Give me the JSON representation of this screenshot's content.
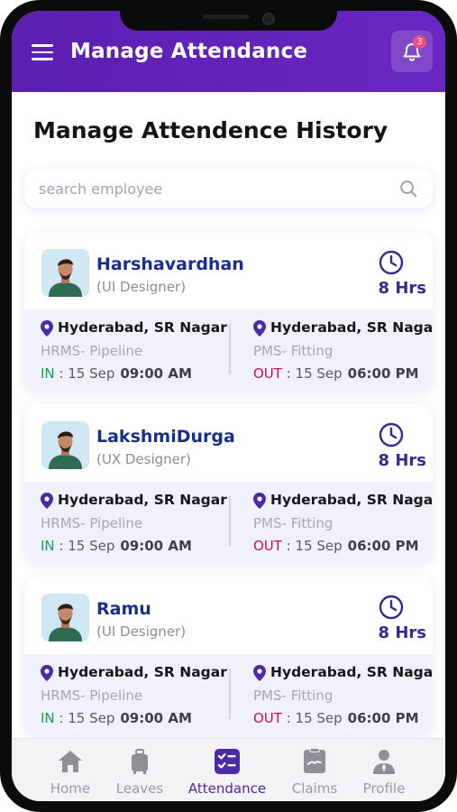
{
  "header": {
    "title": "Manage Attendance",
    "notification_count": "3"
  },
  "page": {
    "title": "Manage Attendence History"
  },
  "search": {
    "placeholder": "search employee",
    "value": ""
  },
  "employees": [
    {
      "name": "Harshavardhan",
      "role": "(UI Designer)",
      "hours": "8 Hrs",
      "in_location": "Hyderabad, SR Nagar",
      "in_project": "HRMS- Pipeline",
      "in_tag": "IN",
      "in_date": " : 15 Sep",
      "in_time": "09:00 AM",
      "out_location": "Hyderabad, SR Nagar",
      "out_project": "PMS- Fitting",
      "out_tag": "OUT",
      "out_date": " : 15 Sep",
      "out_time": "06:00 PM"
    },
    {
      "name": "LakshmiDurga",
      "role": "(UX Designer)",
      "hours": "8 Hrs",
      "in_location": "Hyderabad, SR Nagar",
      "in_project": "HRMS- Pipeline",
      "in_tag": "IN",
      "in_date": " : 15 Sep",
      "in_time": "09:00 AM",
      "out_location": "Hyderabad, SR Nagar",
      "out_project": "PMS- Fitting",
      "out_tag": "OUT",
      "out_date": " : 15 Sep",
      "out_time": "06:00 PM"
    },
    {
      "name": "Ramu",
      "role": "(UI Designer)",
      "hours": "8 Hrs",
      "in_location": "Hyderabad, SR Nagar",
      "in_project": "HRMS- Pipeline",
      "in_tag": "IN",
      "in_date": " : 15 Sep",
      "in_time": "09:00 AM",
      "out_location": "Hyderabad, SR Nagar",
      "out_project": "PMS- Fitting",
      "out_tag": "OUT",
      "out_date": " : 15 Sep",
      "out_time": "06:00 PM"
    }
  ],
  "bottom_nav": {
    "active": "Attendance",
    "items": [
      {
        "label": "Home",
        "icon": "home-icon"
      },
      {
        "label": "Leaves",
        "icon": "luggage-icon"
      },
      {
        "label": "Attendance",
        "icon": "checklist-icon"
      },
      {
        "label": "Claims",
        "icon": "claims-icon"
      },
      {
        "label": "Profile",
        "icon": "person-icon"
      }
    ]
  },
  "colors": {
    "header": "#6024b8",
    "accent": "#4b2aa8",
    "name": "#1b2e8c",
    "in": "#16a34a",
    "out": "#c0134d"
  }
}
